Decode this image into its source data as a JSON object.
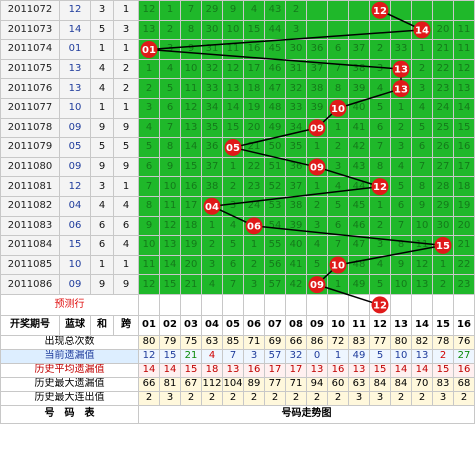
{
  "trend_chart": {
    "header": {
      "issue_col": "开奖期号",
      "blue_col": "蓝球",
      "sum_col": "和",
      "span_col": "跨",
      "numbers": [
        "01",
        "02",
        "03",
        "04",
        "05",
        "06",
        "07",
        "08",
        "09",
        "10",
        "11",
        "12",
        "13",
        "14",
        "15",
        "16"
      ]
    },
    "draws": [
      {
        "issue": "2011072",
        "blue": "12",
        "sum": "3",
        "span": "1",
        "cells": [
          "12",
          "1",
          "7",
          "29",
          "9",
          "4",
          "43",
          "2",
          "",
          "",
          "",
          "12",
          "",
          "",
          "",
          ""
        ]
      },
      {
        "issue": "2011073",
        "blue": "14",
        "sum": "5",
        "span": "3",
        "cells": [
          "13",
          "2",
          "8",
          "30",
          "10",
          "15",
          "44",
          "3",
          "",
          "",
          "",
          "",
          "",
          "14",
          "20",
          "11"
        ]
      },
      {
        "issue": "2011074",
        "blue": "01",
        "sum": "1",
        "span": "1",
        "cells": [
          "01",
          "3",
          "9",
          "31",
          "11",
          "16",
          "45",
          "30",
          "36",
          "6",
          "37",
          "2",
          "33",
          "1",
          "21",
          "11"
        ]
      },
      {
        "issue": "2011075",
        "blue": "13",
        "sum": "4",
        "span": "2",
        "cells": [
          "1",
          "4",
          "10",
          "32",
          "12",
          "17",
          "46",
          "31",
          "37",
          "7",
          "38",
          "3",
          "13",
          "2",
          "22",
          "12"
        ]
      },
      {
        "issue": "2011076",
        "blue": "13",
        "sum": "4",
        "span": "2",
        "cells": [
          "2",
          "5",
          "11",
          "33",
          "13",
          "18",
          "47",
          "32",
          "38",
          "8",
          "39",
          "4",
          "13",
          "3",
          "23",
          "13"
        ]
      },
      {
        "issue": "2011077",
        "blue": "10",
        "sum": "1",
        "span": "1",
        "cells": [
          "3",
          "6",
          "12",
          "34",
          "14",
          "19",
          "48",
          "33",
          "39",
          "10",
          "40",
          "5",
          "1",
          "4",
          "24",
          "14"
        ]
      },
      {
        "issue": "2011078",
        "blue": "09",
        "sum": "9",
        "span": "9",
        "cells": [
          "4",
          "7",
          "13",
          "35",
          "15",
          "20",
          "49",
          "34",
          "09",
          "1",
          "41",
          "6",
          "2",
          "5",
          "25",
          "15"
        ]
      },
      {
        "issue": "2011079",
        "blue": "05",
        "sum": "5",
        "span": "5",
        "cells": [
          "5",
          "8",
          "14",
          "36",
          "05",
          "21",
          "50",
          "35",
          "1",
          "2",
          "42",
          "7",
          "3",
          "6",
          "26",
          "16"
        ]
      },
      {
        "issue": "2011080",
        "blue": "09",
        "sum": "9",
        "span": "9",
        "cells": [
          "6",
          "9",
          "15",
          "37",
          "1",
          "22",
          "51",
          "36",
          "09",
          "3",
          "43",
          "8",
          "4",
          "7",
          "27",
          "17"
        ]
      },
      {
        "issue": "2011081",
        "blue": "12",
        "sum": "3",
        "span": "1",
        "cells": [
          "7",
          "10",
          "16",
          "38",
          "2",
          "23",
          "52",
          "37",
          "1",
          "4",
          "44",
          "12",
          "5",
          "8",
          "28",
          "18"
        ]
      },
      {
        "issue": "2011082",
        "blue": "04",
        "sum": "4",
        "span": "4",
        "cells": [
          "8",
          "11",
          "17",
          "04",
          "3",
          "24",
          "53",
          "38",
          "2",
          "5",
          "45",
          "1",
          "6",
          "9",
          "29",
          "19"
        ]
      },
      {
        "issue": "2011083",
        "blue": "06",
        "sum": "6",
        "span": "6",
        "cells": [
          "9",
          "12",
          "18",
          "1",
          "4",
          "06",
          "54",
          "39",
          "3",
          "6",
          "46",
          "2",
          "7",
          "10",
          "30",
          "20"
        ]
      },
      {
        "issue": "2011084",
        "blue": "15",
        "sum": "6",
        "span": "4",
        "cells": [
          "10",
          "13",
          "19",
          "2",
          "5",
          "1",
          "55",
          "40",
          "4",
          "7",
          "47",
          "3",
          "8",
          "11",
          "15",
          "21"
        ]
      },
      {
        "issue": "2011085",
        "blue": "10",
        "sum": "1",
        "span": "1",
        "cells": [
          "11",
          "14",
          "20",
          "3",
          "6",
          "2",
          "56",
          "41",
          "5",
          "10",
          "48",
          "4",
          "9",
          "12",
          "1",
          "22"
        ]
      },
      {
        "issue": "2011086",
        "blue": "09",
        "sum": "9",
        "span": "9",
        "cells": [
          "12",
          "15",
          "21",
          "4",
          "7",
          "3",
          "57",
          "42",
          "09",
          "1",
          "49",
          "5",
          "10",
          "13",
          "2",
          "23"
        ]
      }
    ],
    "prediction": {
      "label": "预测行",
      "ball": "12"
    },
    "stats": [
      {
        "label": "出现总次数",
        "color": "#000000",
        "values": [
          "80",
          "79",
          "75",
          "63",
          "85",
          "71",
          "69",
          "66",
          "86",
          "72",
          "83",
          "77",
          "80",
          "82",
          "78",
          "76"
        ]
      },
      {
        "label": "当前遗漏值",
        "color": "#1f3c9c",
        "values": [
          "12",
          "15",
          "21",
          "4",
          "7",
          "3",
          "57",
          "32",
          "0",
          "1",
          "49",
          "5",
          "10",
          "13",
          "2",
          "27"
        ]
      },
      {
        "label": "历史平均遗漏值",
        "color": "#c00000",
        "values": [
          "14",
          "14",
          "15",
          "18",
          "13",
          "16",
          "17",
          "17",
          "13",
          "16",
          "13",
          "15",
          "14",
          "14",
          "15",
          "16"
        ]
      },
      {
        "label": "历史最大遗漏值",
        "color": "#000000",
        "values": [
          "66",
          "81",
          "67",
          "112",
          "104",
          "89",
          "77",
          "71",
          "94",
          "60",
          "63",
          "84",
          "84",
          "70",
          "83",
          "68"
        ]
      },
      {
        "label": "历史最大连出值",
        "color": "#000000",
        "values": [
          "2",
          "3",
          "2",
          "2",
          "2",
          "2",
          "2",
          "2",
          "2",
          "2",
          "3",
          "3",
          "2",
          "2",
          "3",
          "2"
        ]
      }
    ],
    "footer": {
      "left": "号　码　表",
      "right": "号码走势图"
    },
    "colors": {
      "ball": "#e01a1a",
      "grid": "#1fb82a",
      "line": "#000000"
    }
  }
}
